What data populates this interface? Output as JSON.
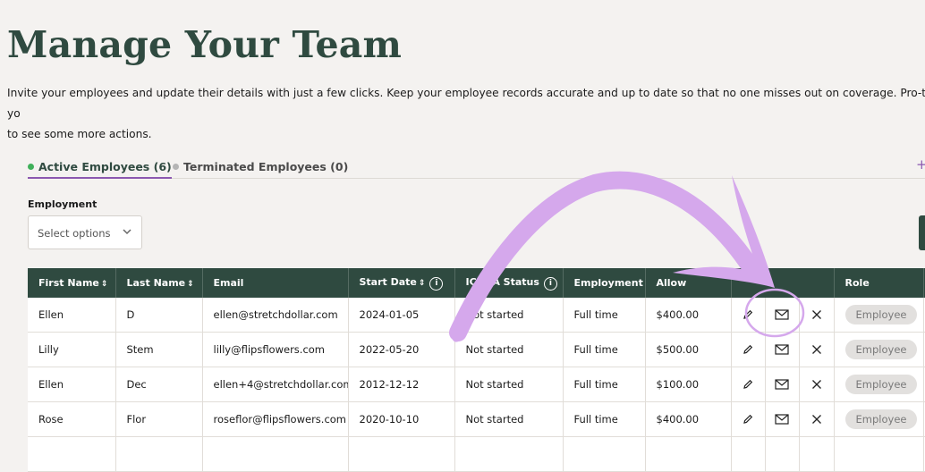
{
  "header": {
    "title": "Manage Your Team",
    "intro_line1": "Invite your employees and update their details with just a few clicks. Keep your employee records accurate and up to date so that no one misses out on coverage. Pro-tip: yo",
    "intro_line2": "to see some more actions."
  },
  "tabs": [
    {
      "label": "Active Employees (6)",
      "active": true,
      "dot_color": "#3fb05a"
    },
    {
      "label": "Terminated Employees (0)",
      "active": false,
      "dot_color": "#b5b5b5"
    }
  ],
  "add_icon": "+",
  "filter": {
    "label": "Employment",
    "placeholder": "Select options"
  },
  "table": {
    "headers": {
      "first_name": "First Name",
      "last_name": "Last Name",
      "email": "Email",
      "start_date": "Start Date",
      "ichra_status": "ICHRA Status",
      "employment": "Employment",
      "allowance": "Allow",
      "role": "Role"
    },
    "rows": [
      {
        "first": "Ellen",
        "last": "D",
        "email": "ellen@stretchdollar.com",
        "start": "2024-01-05",
        "status": "Not started",
        "employment": "Full time",
        "allowance": "$400.00",
        "role": "Employee"
      },
      {
        "first": "Lilly",
        "last": "Stem",
        "email": "lilly@flipsflowers.com",
        "start": "2022-05-20",
        "status": "Not started",
        "employment": "Full time",
        "allowance": "$500.00",
        "role": "Employee"
      },
      {
        "first": "Ellen",
        "last": "Dec",
        "email": "ellen+4@stretchdollar.com",
        "start": "2012-12-12",
        "status": "Not started",
        "employment": "Full time",
        "allowance": "$100.00",
        "role": "Employee"
      },
      {
        "first": "Rose",
        "last": "Flor",
        "email": "roseflor@flipsflowers.com",
        "start": "2020-10-10",
        "status": "Not started",
        "employment": "Full time",
        "allowance": "$400.00",
        "role": "Employee"
      }
    ]
  },
  "colors": {
    "header_bg": "#2f4a40",
    "accent": "#8b58b0",
    "annotation": "#d5a8ec"
  }
}
